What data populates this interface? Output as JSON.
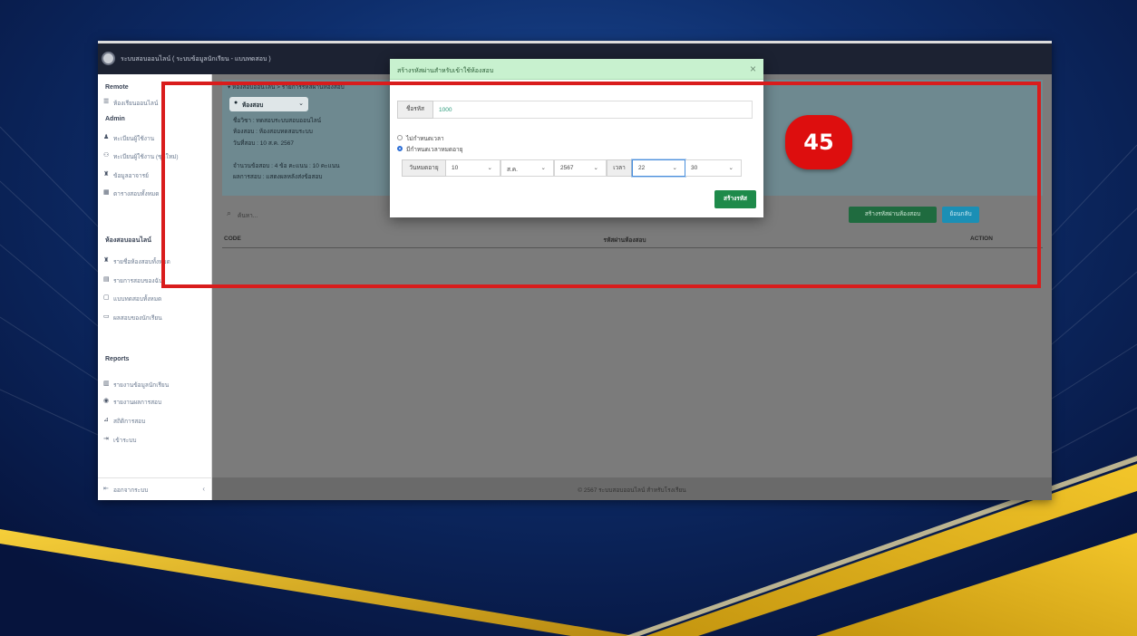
{
  "slide": {
    "badge_number": "45"
  },
  "colors": {
    "highlight_red": "#d91c1c",
    "badge_red": "#dd0e0e",
    "modal_header": "#c8f1cf",
    "submit_green": "#1e8a4a",
    "create_green": "#1f6b3f",
    "back_blue": "#1b8fb5",
    "gold": "#f2c21a",
    "navy": "#0e2e6c"
  },
  "app": {
    "window_title": "ระบบสอบออนไลน์ ( ระบบข้อมูลนักเรียน - แบบทดสอบ )",
    "sidebar": {
      "sections": [
        {
          "heading": "Remote",
          "items": [
            {
              "icon": "list-icon",
              "glyph": "☰",
              "label": "ห้องเรียนออนไลน์"
            }
          ]
        },
        {
          "heading": "Admin",
          "items": [
            {
              "icon": "user-icon",
              "glyph": "♟",
              "label": "ทะเบียนผู้ใช้งาน"
            },
            {
              "icon": "users-icon",
              "glyph": "⚇",
              "label": "ทะเบียนผู้ใช้งาน (ชุดใหม่)"
            },
            {
              "icon": "teacher-icon",
              "glyph": "♜",
              "label": "ข้อมูลอาจารย์"
            },
            {
              "icon": "table-icon",
              "glyph": "▦",
              "label": "ตารางสอบทั้งหมด"
            }
          ]
        },
        {
          "heading": "ห้องสอบออนไลน์",
          "items": [
            {
              "icon": "room-icon",
              "glyph": "♜",
              "label": "รายชื่อห้องสอบทั้งหมด"
            },
            {
              "icon": "exam-icon",
              "glyph": "▤",
              "label": "รายการสอบของฉัน"
            },
            {
              "icon": "test-icon",
              "glyph": "▢",
              "label": "แบบทดสอบทั้งหมด"
            },
            {
              "icon": "result-icon",
              "glyph": "▭",
              "label": "ผลสอบของนักเรียน"
            }
          ]
        },
        {
          "heading": "Reports",
          "items": [
            {
              "icon": "report-icon",
              "glyph": "▥",
              "label": "รายงานข้อมูลนักเรียน"
            },
            {
              "icon": "chart-icon",
              "glyph": "◉",
              "label": "รายงานผลการสอบ"
            },
            {
              "icon": "stats-icon",
              "glyph": "⊿",
              "label": "สถิติการสอบ"
            },
            {
              "icon": "login-icon",
              "glyph": "⇥",
              "label": "เข้าระบบ"
            }
          ]
        }
      ],
      "logout": {
        "icon": "logout-icon",
        "glyph": "⇤",
        "label": "ออกจากระบบ",
        "chevron": "‹"
      }
    },
    "main": {
      "breadcrumb": "▾ ห้องสอบออนไลน์ > รายการรหัสผ่านห้องสอบ",
      "room_pill": {
        "dot": "●",
        "label": "ห้องสอบ",
        "chevron": "⌄"
      },
      "info_lines": [
        "ชื่อวิชา : ทดสอบระบบสอบออนไลน์",
        "ห้องสอบ : ห้องสอบทดสอบระบบ",
        "วันที่สอบ : 10 ส.ค. 2567",
        "จำนวนข้อสอบ : 4 ข้อ  คะแนน : 10 คะแนน",
        "ผลการสอบ : แสดงผลหลังส่งข้อสอบ"
      ],
      "search": {
        "glyph": "⌕",
        "placeholder": "ค้นหา..."
      },
      "create_button": "สร้างรหัสผ่านห้องสอบ",
      "back_button": "ย้อนกลับ",
      "table_headers": [
        "CODE",
        "รหัสผ่านห้องสอบ",
        "ACTION"
      ],
      "footer": "© 2567 ระบบสอบออนไลน์ สำหรับโรงเรียน"
    },
    "modal": {
      "title": "สร้างรหัสผ่านสำหรับเข้าใช้ห้องสอบ",
      "close_glyph": "×",
      "code_label": "ชื่อรหัส",
      "code_value": "1000",
      "radio_options": [
        {
          "label": "ไม่กำหนดเวลา",
          "checked": false
        },
        {
          "label": "มีกำหนดเวลาหมดอายุ",
          "checked": true
        }
      ],
      "expiry_label": "วันหมดอายุ",
      "day": "10",
      "month": "ส.ค.",
      "year": "2567",
      "time_label": "เวลา",
      "hour": "22",
      "minute": "30",
      "caret": "⌄",
      "submit_label": "สร้างรหัส"
    }
  }
}
